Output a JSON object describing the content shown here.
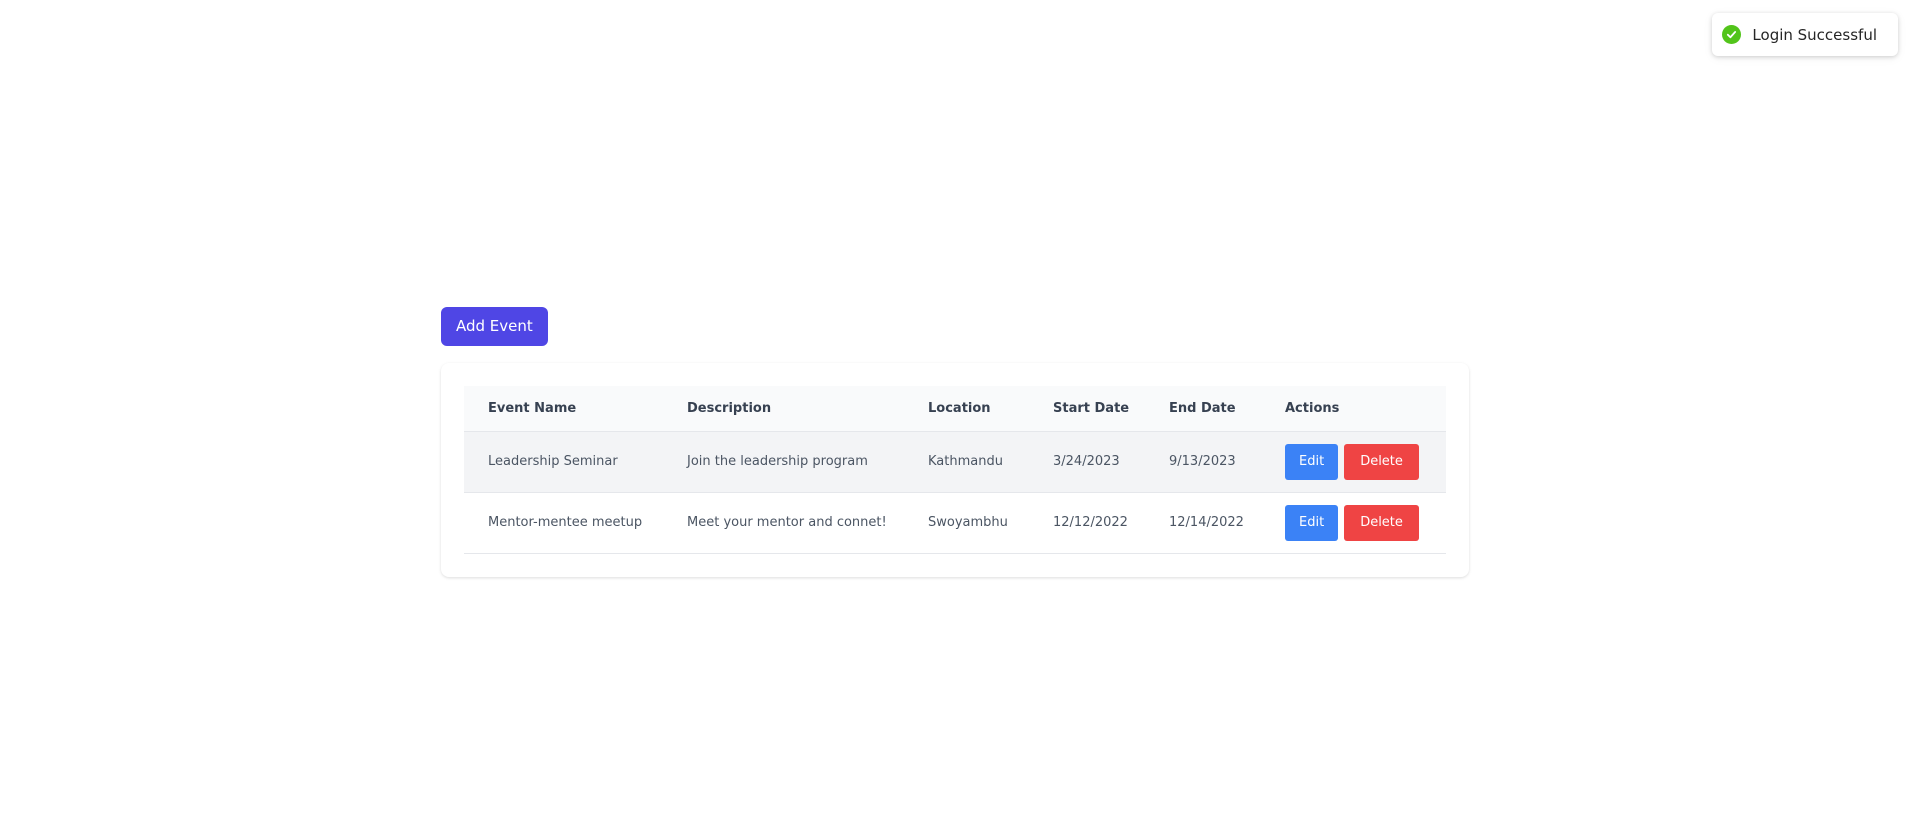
{
  "toast": {
    "message": "Login Successful",
    "icon": "check-circle-icon",
    "color": "#52c41a"
  },
  "toolbar": {
    "add_event_label": "Add Event",
    "accent_color": "#4f46e5"
  },
  "table": {
    "headers": [
      "Event Name",
      "Description",
      "Location",
      "Start Date",
      "End Date",
      "Actions"
    ],
    "rows": [
      {
        "name": "Leadership Seminar",
        "description": "Join the leadership program",
        "location": "Kathmandu",
        "start_date": "3/24/2023",
        "end_date": "9/13/2023",
        "edit_label": "Edit",
        "delete_label": "Delete"
      },
      {
        "name": "Mentor-mentee meetup",
        "description": "Meet your mentor and connet!",
        "location": "Swoyambhu",
        "start_date": "12/12/2022",
        "end_date": "12/14/2022",
        "edit_label": "Edit",
        "delete_label": "Delete"
      }
    ],
    "edit_color": "#3b82f6",
    "delete_color": "#ef4444"
  }
}
